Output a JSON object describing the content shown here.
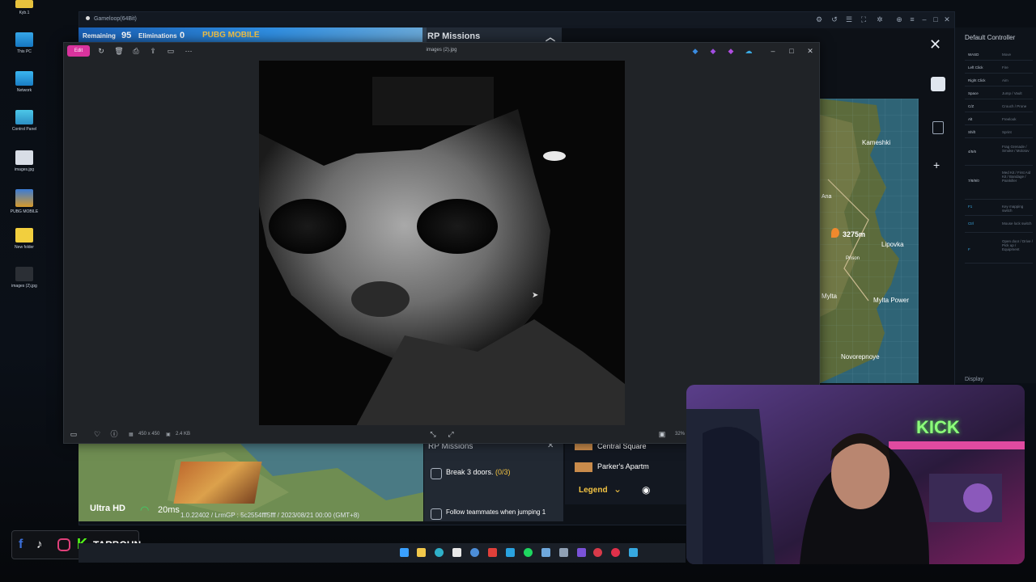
{
  "desktop": {
    "icons": [
      {
        "label": "Kyb.1",
        "icon": "folder-icon"
      },
      {
        "label": "This PC",
        "icon": "monitor-icon"
      },
      {
        "label": "Network",
        "icon": "network-icon"
      },
      {
        "label": "Control Panel",
        "icon": "control-panel-icon"
      },
      {
        "label": "images.jpg",
        "icon": "image-file-icon"
      },
      {
        "label": "PUBG MOBILE",
        "icon": "game-icon"
      },
      {
        "label": "New folder",
        "icon": "folder-icon"
      },
      {
        "label": "images (2).jpg",
        "icon": "image-file-icon"
      }
    ]
  },
  "emulator": {
    "title": "Gameloop(64Bit)"
  },
  "game": {
    "remaining_label": "Remaining",
    "remaining_value": "95",
    "eliminations_label": "Eliminations",
    "eliminations_value": "0",
    "logo_text": "PUBG MOBILE",
    "rp_missions_title": "RP Missions",
    "bottom_missions_title": "RP Missions",
    "missions": [
      {
        "text": "Break 3 doors.",
        "progress": "(0/3)"
      },
      {
        "text": "Follow teammates when jumping 1"
      }
    ],
    "places": [
      "Central Square",
      "Parker's Apartm"
    ],
    "legend_label": "Legend",
    "quality_label": "Ultra HD",
    "ping_label": "20ms",
    "build_text": "1.0.22402 / LrmGP : 5c2554fff5fff / 2023/08/21 00:00 (GMT+8)"
  },
  "photo_viewer": {
    "title": "images (2).jpg",
    "edit_label": "Edit",
    "dimensions": "450 x 450",
    "file_size": "2.4 KB",
    "zoom": "32%"
  },
  "map": {
    "towns": [
      "Kameshki",
      "Lipovka",
      "Mylta Power",
      "Mylta",
      "Novorepnoye",
      "Prison",
      "Ana"
    ],
    "distance_marker": "3275m"
  },
  "controller": {
    "title": "Default Controller",
    "rows": [
      {
        "key": "WASD",
        "action": "Move"
      },
      {
        "key": "Left Click",
        "action": "Fire"
      },
      {
        "key": "Right Click",
        "action": "Aim"
      },
      {
        "key": "Space",
        "action": "Jump / Vault"
      },
      {
        "key": "C/Z",
        "action": "Crouch / Prone"
      },
      {
        "key": "Alt",
        "action": "Freelook"
      },
      {
        "key": "Shift",
        "action": "Sprint"
      },
      {
        "key": "4/5/6",
        "action": "Frag Grenade / Smoke / Molotov"
      },
      {
        "key": "7/8/9/0",
        "action": "Med Kit / First Aid Kit / Bandage / Painkiller"
      },
      {
        "key": "F1",
        "action": "Key mapping switch"
      },
      {
        "key": "Ctrl",
        "action": "Mouse lock switch"
      },
      {
        "key": "F",
        "action": "Open door / Drive / Pick up / Equipment"
      }
    ],
    "display_label": "Display"
  },
  "stream": {
    "channel": "TARBOUN",
    "neon_sign": "KICK"
  },
  "taskbar": {
    "icons": [
      "windows-icon",
      "file-explorer-icon",
      "edge-icon",
      "notepad-icon",
      "chrome-icon",
      "telegram-icon",
      "spotify-icon",
      "settings-icon",
      "steam-icon",
      "opera-icon",
      "purple-app-icon",
      "red-app-icon",
      "red-app2-icon",
      "photos-app-icon"
    ]
  }
}
